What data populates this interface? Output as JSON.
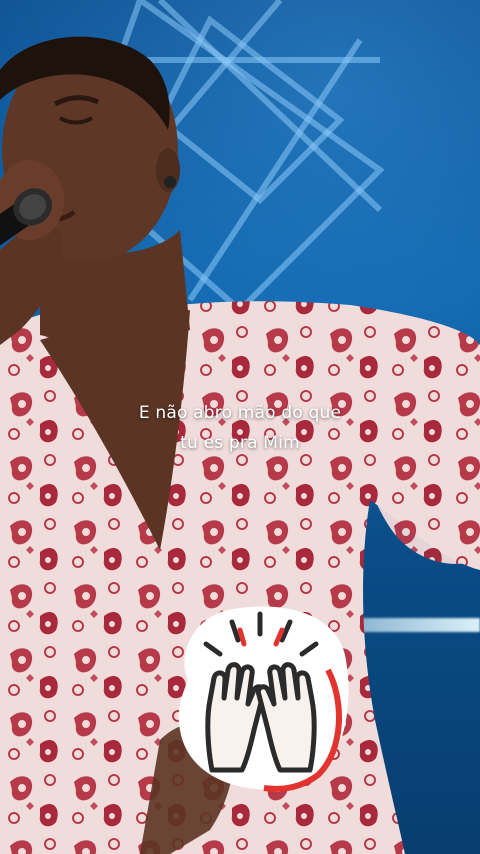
{
  "video": {
    "caption_lines": [
      "E não abro mão do que",
      "tu es pra Mim"
    ],
    "sticker_icon": "raised-hands-icon"
  },
  "colors": {
    "background": "#0b4c8c",
    "dress_base": "#f1dcdc",
    "dress_pattern": "#b73a4a",
    "skin": "#5b3424",
    "sticker_accent": "#e2332f"
  }
}
